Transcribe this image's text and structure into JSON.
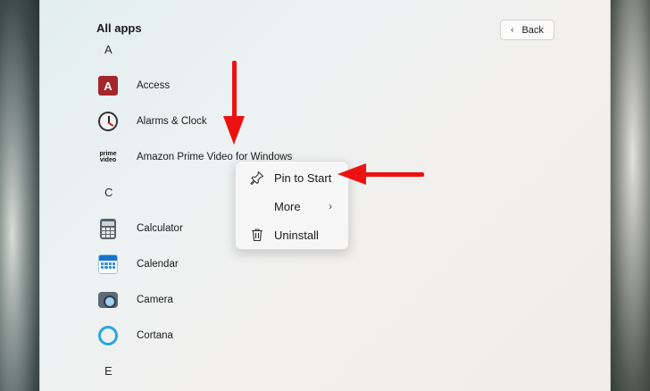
{
  "header": {
    "title": "All apps",
    "back_label": "Back"
  },
  "sections": [
    {
      "letter": "A",
      "apps": [
        {
          "name": "Access",
          "icon": "access-icon"
        },
        {
          "name": "Alarms & Clock",
          "icon": "alarm-clock-icon"
        },
        {
          "name": "Amazon Prime Video for Windows",
          "icon": "prime-video-icon",
          "icon_text": "prime video"
        }
      ]
    },
    {
      "letter": "C",
      "apps": [
        {
          "name": "Calculator",
          "icon": "calculator-icon"
        },
        {
          "name": "Calendar",
          "icon": "calendar-icon"
        },
        {
          "name": "Camera",
          "icon": "camera-icon"
        },
        {
          "name": "Cortana",
          "icon": "cortana-icon"
        }
      ]
    },
    {
      "letter": "E",
      "apps": []
    }
  ],
  "context_menu": {
    "items": [
      {
        "label": "Pin to Start",
        "icon": "pin-icon"
      },
      {
        "label": "More",
        "icon": "",
        "submenu": true
      },
      {
        "label": "Uninstall",
        "icon": "trash-icon"
      }
    ]
  },
  "colors": {
    "annotation_arrow": "#ee1111",
    "accent": "#2aa7e0"
  }
}
